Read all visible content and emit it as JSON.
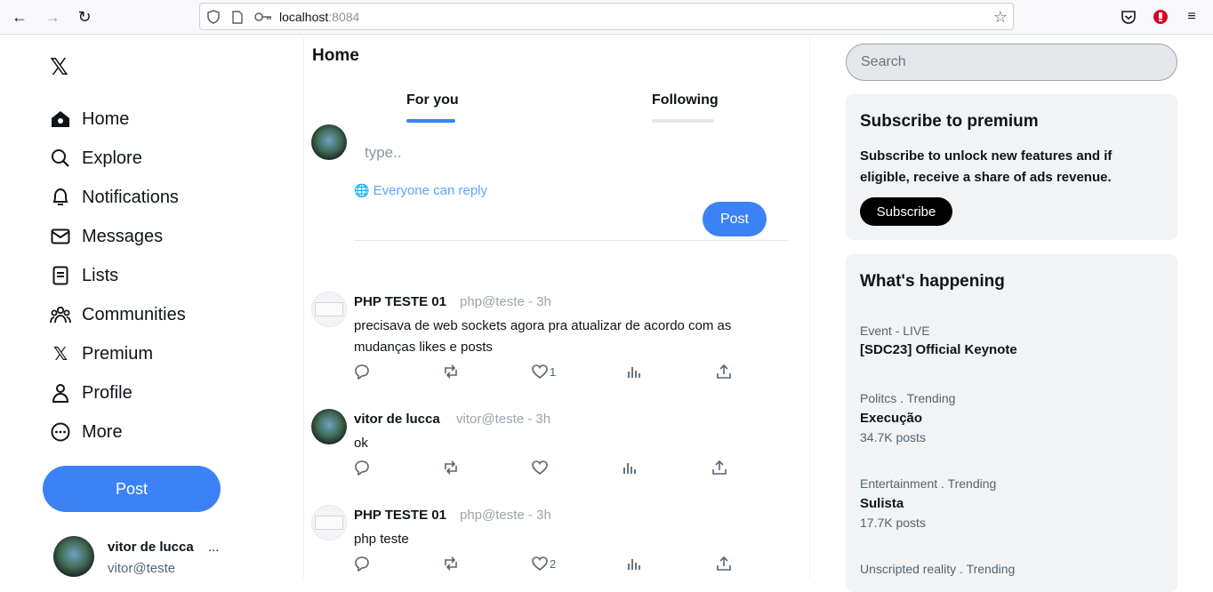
{
  "browser": {
    "url_host": "localhost",
    "url_port": ":8084"
  },
  "sidebar": {
    "logo": "𝕏",
    "items": [
      {
        "label": "Home",
        "icon": "home-icon"
      },
      {
        "label": "Explore",
        "icon": "search-icon"
      },
      {
        "label": "Notifications",
        "icon": "bell-icon"
      },
      {
        "label": "Messages",
        "icon": "mail-icon"
      },
      {
        "label": "Lists",
        "icon": "list-icon"
      },
      {
        "label": "Communities",
        "icon": "communities-icon"
      },
      {
        "label": "Premium",
        "icon": "x-icon"
      },
      {
        "label": "Profile",
        "icon": "user-icon"
      },
      {
        "label": "More",
        "icon": "more-circle-icon"
      }
    ],
    "post_button": "Post",
    "user": {
      "name": "vitor de lucca",
      "handle": "vitor@teste",
      "more": "..."
    }
  },
  "main": {
    "title": "Home",
    "tabs": [
      {
        "label": "For you",
        "active": true
      },
      {
        "label": "Following",
        "active": false
      }
    ],
    "compose": {
      "placeholder": "type..",
      "reply_scope": "Everyone can reply",
      "post_button": "Post"
    },
    "tweets": [
      {
        "name": "PHP TESTE 01",
        "handle": "php@teste - 3h",
        "text": "precisava de web sockets agora pra atualizar de acordo com as mudanças likes e posts",
        "likes": "1",
        "avatar": "gray"
      },
      {
        "name": "vitor de lucca",
        "handle": "vitor@teste - 3h",
        "text": "ok",
        "likes": "",
        "avatar": "photo"
      },
      {
        "name": "PHP TESTE 01",
        "handle": "php@teste - 3h",
        "text": "php teste",
        "likes": "2",
        "avatar": "gray"
      }
    ]
  },
  "right": {
    "search_placeholder": "Search",
    "premium": {
      "title": "Subscribe to premium",
      "description": "Subscribe to unlock new features and if eligible, receive a share of ads revenue.",
      "button": "Subscribe"
    },
    "happening": {
      "title": "What's happening",
      "trends": [
        {
          "category": "Event - LIVE",
          "title": "[SDC23] Official Keynote",
          "count": ""
        },
        {
          "category": "Politcs . Trending",
          "title": "Execução",
          "count": "34.7K posts"
        },
        {
          "category": "Entertainment . Trending",
          "title": "Sulista",
          "count": "17.7K posts"
        },
        {
          "category": "Unscripted reality . Trending",
          "title": "",
          "count": ""
        }
      ]
    }
  },
  "colors": {
    "accent": "#3b82f6",
    "link": "#60a5fa",
    "card_bg": "#f2f3f5",
    "muted": "#9ca3af"
  }
}
